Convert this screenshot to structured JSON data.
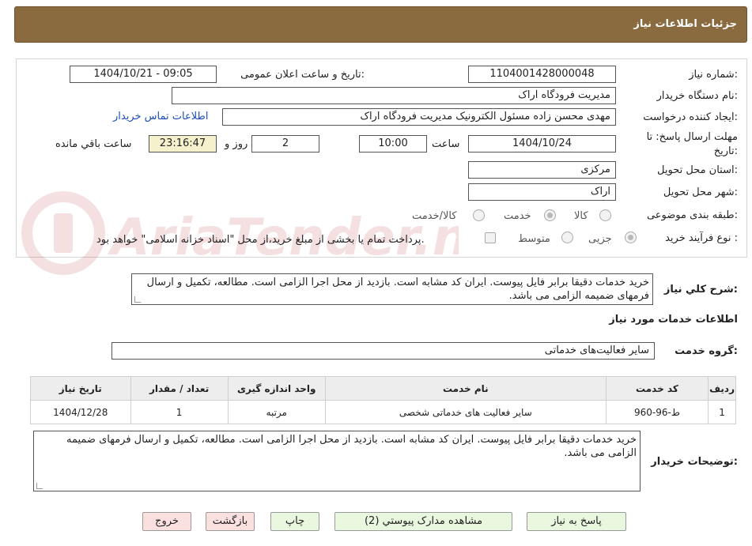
{
  "header": {
    "title": "جزئیات اطلاعات نیاز"
  },
  "fields": {
    "need_number_label": "شماره نیاز:",
    "need_number": "1104001428000048",
    "announce_label": "تاریخ و ساعت اعلان عمومی:",
    "announce_value": "1404/10/21 - 09:05",
    "buyer_org_label": "نام دستگاه خریدار:",
    "buyer_org": "مدیریت فرودگاه اراک",
    "creator_label": "ایجاد کننده درخواست:",
    "creator": "مهدی محسن زاده مسئول الکترونیک مدیریت فرودگاه اراک",
    "contact_link": "اطلاعات تماس خریدار",
    "deadline_label_1": "مهلت ارسال پاسخ: تا",
    "deadline_label_2": "تاریخ:",
    "deadline_date": "1404/10/24",
    "time_label": "ساعت",
    "deadline_time": "10:00",
    "days_value": "2",
    "days_label": "روز و",
    "remaining_time": "23:16:47",
    "remaining_label": "ساعت باقي مانده",
    "province_label": "استان محل تحویل:",
    "province": "مرکزی",
    "city_label": "شهر محل تحویل:",
    "city": "اراک",
    "category_label": "طبقه بندی موضوعی:",
    "category_options": [
      "کالا",
      "خدمت",
      "کالا/خدمت"
    ],
    "process_label": "نوع فرآیند خرید :",
    "process_options": [
      "جزیی",
      "متوسط"
    ],
    "payment_note": "پرداخت تمام یا بخشی از مبلغ خرید،از محل \"اسناد خزانه اسلامی\" خواهد بود."
  },
  "description": {
    "label": "شرح کلي نياز:",
    "text": "خرید خدمات دقیقا برابر فایل پیوست. ایران کد مشابه است. بازدید از محل اجرا الزامی است. مطالعه، تکمیل و ارسال فرمهای ضمیمه الزامی می باشد."
  },
  "services_section": {
    "title": "اطلاعات خدمات مورد نياز",
    "group_label": "گروه خدمت:",
    "group_value": "سایر فعالیت‌های خدماتی"
  },
  "table": {
    "headers": [
      "ردیف",
      "کد خدمت",
      "نام خدمت",
      "واحد اندازه گیری",
      "تعداد / مقدار",
      "تاریخ نیاز"
    ],
    "rows": [
      [
        "1",
        "ط-96-960",
        "سایر فعالیت های خدماتی شخصی",
        "مرتبه",
        "1",
        "1404/12/28"
      ]
    ]
  },
  "buyer_notes": {
    "label": "توضیحات خریدار:",
    "text": "خرید خدمات دقیقا برابر فایل پیوست. ایران کد مشابه است. بازدید از محل اجرا الزامی است. مطالعه، تکمیل و ارسال فرمهای ضمیمه الزامی می باشد."
  },
  "buttons": {
    "reply": "پاسخ به نیاز",
    "attachments": "مشاهده مدارک پیوستي (2)",
    "print": "چاپ",
    "back": "بازگشت",
    "exit": "خروج"
  },
  "colors": {
    "header_bg": "#8a6a3f",
    "link": "#1c4fb8",
    "button_green": "#eaf7df",
    "button_red": "#fbe0e0",
    "remaining_bg": "#f4f1cc"
  }
}
